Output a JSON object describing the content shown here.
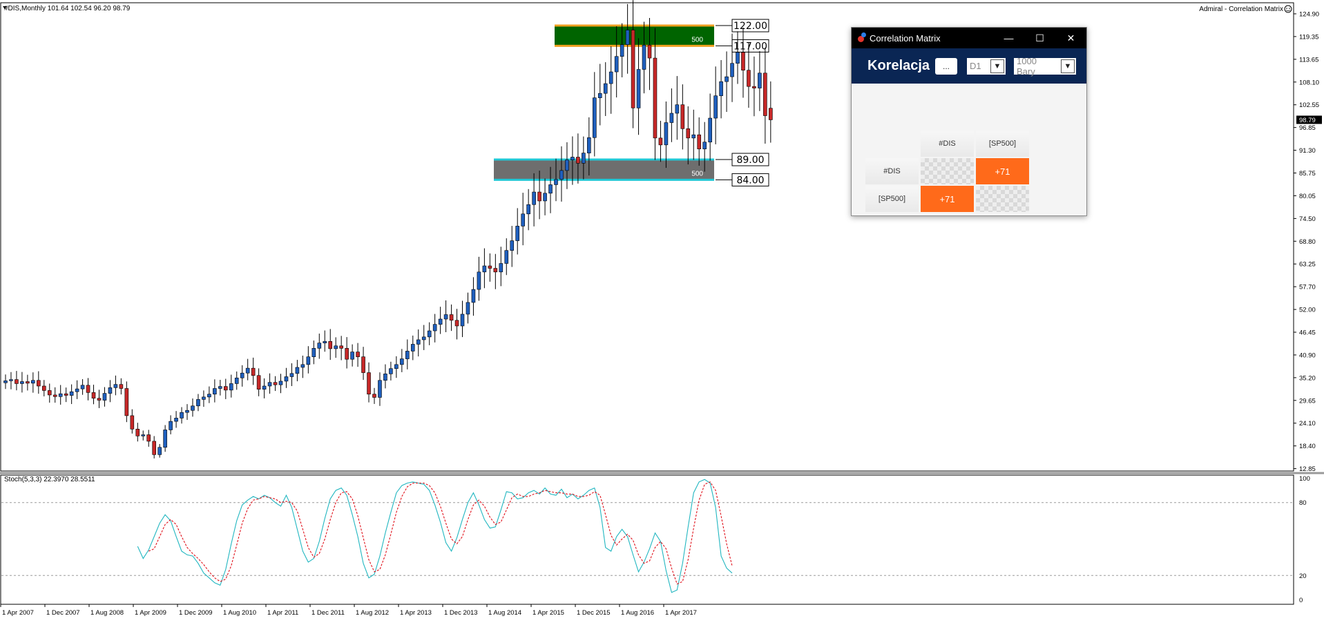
{
  "chart_header": "#DIS,Monthly  101.64 102.54 96.20 98.79",
  "top_right_label": "Admiral - Correlation Matrix",
  "indicator_header": "Stoch(5,3,3) 22.3970 28.5511",
  "current_price_label": "98.79",
  "colors": {
    "bull": "#1f5fbd",
    "bear": "#c62828",
    "stoch_main": "#20b6c0",
    "stoch_signal": "#e0101a",
    "accent": "#ff6a1a",
    "nav": "#0a2654"
  },
  "zones": [
    {
      "id": "resistance",
      "top": 122.0,
      "bottom": 117.0,
      "fill": "#006400",
      "border": "#f0a020",
      "volume": "500",
      "top_label": "122.00",
      "bottom_label": "117.00"
    },
    {
      "id": "support",
      "top": 89.0,
      "bottom": 84.0,
      "fill": "#6e6e6e",
      "border": "#20c8d6",
      "volume": "500",
      "top_label": "89.00",
      "bottom_label": "84.00"
    }
  ],
  "correlation_window": {
    "title": "Correlation Matrix",
    "heading": "Korelacja",
    "dots_button": "...",
    "timeframe": "D1",
    "bars": "1000 Bary",
    "row_headers": [
      "#DIS",
      "[SP500]"
    ],
    "col_headers": [
      "#DIS",
      "[SP500]"
    ],
    "values": [
      [
        "",
        "+71"
      ],
      [
        "+71",
        ""
      ]
    ]
  },
  "chart_data": [
    {
      "type": "candlestick",
      "x_tick_labels": [
        "1 Apr 2007",
        "1 Dec 2007",
        "1 Aug 2008",
        "1 Apr 2009",
        "1 Dec 2009",
        "1 Aug 2010",
        "1 Apr 2011",
        "1 Dec 2011",
        "1 Aug 2012",
        "1 Apr 2013",
        "1 Dec 2013",
        "1 Aug 2014",
        "1 Apr 2015",
        "1 Dec 2015",
        "1 Aug 2016",
        "1 Apr 2017"
      ],
      "y_tick_labels": [
        "124.90",
        "119.35",
        "113.65",
        "108.10",
        "102.55",
        "96.85",
        "91.30",
        "85.75",
        "80.05",
        "74.50",
        "68.80",
        "63.25",
        "57.70",
        "52.00",
        "46.45",
        "40.90",
        "35.20",
        "29.65",
        "24.10",
        "18.40",
        "12.85"
      ],
      "ylim": [
        12.85,
        124.9
      ],
      "x_start": "2007-01",
      "x_end": "2017-06",
      "close": [
        34.5,
        34.8,
        33.8,
        34.3,
        33.9,
        34.6,
        33.2,
        32.1,
        31.0,
        30.6,
        31.3,
        30.9,
        31.8,
        32.5,
        33.4,
        31.6,
        30.2,
        29.7,
        31.4,
        32.8,
        33.6,
        32.6,
        25.9,
        22.6,
        20.9,
        21.2,
        19.6,
        16.3,
        18.1,
        22.4,
        24.5,
        25.3,
        26.7,
        27.2,
        28.3,
        29.9,
        30.5,
        31.2,
        32.6,
        33.1,
        32.2,
        33.8,
        35.2,
        36.4,
        37.6,
        35.8,
        32.4,
        33.2,
        34.1,
        33.5,
        34.4,
        35.5,
        36.3,
        37.8,
        38.5,
        40.4,
        42.5,
        43.8,
        44.2,
        42.4,
        43.1,
        42.5,
        39.8,
        41.6,
        40.4,
        36.5,
        31.2,
        30.4,
        34.6,
        36.2,
        37.5,
        38.5,
        39.9,
        41.8,
        43.5,
        44.6,
        45.3,
        46.8,
        48.4,
        49.7,
        50.8,
        49.4,
        48.0,
        50.9,
        53.8,
        57.0,
        61.3,
        62.8,
        62.2,
        61.3,
        63.4,
        66.6,
        69.0,
        72.6,
        75.6,
        77.9,
        81.0,
        78.8,
        80.7,
        82.8,
        84.1,
        86.3,
        88.9,
        89.6,
        88.1,
        90.6,
        94.4,
        104.2,
        105.3,
        107.7,
        110.6,
        114.4,
        117.3,
        120.9,
        101.7,
        111.2,
        117.2,
        114.0,
        94.3,
        92.6,
        98.1,
        100.4,
        102.5,
        96.6,
        94.3,
        95.1,
        91.6,
        93.3,
        99.2,
        104.7,
        108.2,
        109.4,
        112.7,
        115.4,
        111.0,
        107.0,
        106.6,
        110.3,
        99.8,
        98.79
      ],
      "open": [
        34.0,
        34.5,
        34.8,
        33.8,
        34.3,
        33.9,
        34.6,
        33.2,
        32.1,
        31.0,
        30.6,
        31.3,
        30.9,
        31.8,
        32.5,
        33.4,
        31.6,
        30.2,
        29.7,
        31.4,
        32.8,
        33.6,
        32.6,
        25.9,
        22.6,
        20.9,
        21.2,
        19.6,
        16.3,
        18.1,
        22.4,
        24.5,
        25.3,
        26.7,
        27.2,
        28.3,
        29.9,
        30.5,
        31.2,
        32.6,
        33.1,
        32.2,
        33.8,
        35.2,
        36.4,
        37.6,
        35.8,
        32.4,
        33.2,
        34.1,
        33.5,
        34.4,
        35.5,
        36.3,
        37.8,
        38.5,
        40.4,
        42.5,
        43.8,
        44.2,
        42.4,
        43.1,
        42.5,
        39.8,
        41.6,
        40.4,
        36.5,
        31.2,
        30.4,
        34.6,
        36.2,
        37.5,
        38.5,
        39.9,
        41.8,
        43.5,
        44.6,
        45.3,
        46.8,
        48.4,
        49.7,
        50.8,
        49.4,
        48.0,
        50.9,
        53.8,
        57.0,
        61.3,
        62.8,
        62.2,
        61.3,
        63.4,
        66.6,
        69.0,
        72.6,
        75.6,
        77.9,
        81.0,
        78.8,
        80.7,
        82.8,
        84.1,
        86.3,
        88.9,
        89.6,
        88.1,
        90.6,
        94.4,
        104.2,
        105.3,
        107.7,
        110.6,
        114.4,
        117.3,
        120.9,
        101.7,
        111.2,
        117.2,
        114.0,
        94.3,
        92.6,
        98.1,
        100.4,
        102.5,
        96.6,
        94.3,
        95.1,
        91.6,
        93.3,
        99.2,
        104.7,
        108.2,
        109.4,
        112.7,
        115.4,
        111.0,
        107.0,
        106.6,
        110.3,
        101.64
      ]
    },
    {
      "type": "line",
      "name": "Stoch(5,3,3)",
      "ylim": [
        0,
        100
      ],
      "y_tick_labels": [
        "100",
        "80",
        "20",
        "0"
      ],
      "levels": [
        80,
        20
      ],
      "x_start": "2009-01",
      "series": [
        {
          "role": "main",
          "values": [
            44,
            34,
            41,
            52,
            63,
            70,
            65,
            52,
            40,
            37,
            36,
            30,
            22,
            18,
            14,
            12,
            25,
            46,
            65,
            78,
            82,
            85,
            83,
            86,
            84,
            80,
            77,
            86,
            76,
            58,
            40,
            31,
            34,
            48,
            67,
            83,
            90,
            92,
            86,
            70,
            52,
            30,
            18,
            21,
            36,
            55,
            72,
            88,
            94,
            96,
            97,
            96,
            95,
            90,
            78,
            64,
            47,
            40,
            51,
            66,
            80,
            88,
            78,
            66,
            59,
            60,
            74,
            89,
            88,
            83,
            84,
            88,
            90,
            87,
            92,
            87,
            86,
            91,
            84,
            87,
            83,
            86,
            90,
            92,
            76,
            43,
            40,
            52,
            58,
            52,
            37,
            23,
            31,
            42,
            55,
            48,
            24,
            6,
            8,
            30,
            60,
            88,
            97,
            99,
            96,
            76,
            36,
            26,
            22
          ]
        },
        {
          "role": "signal",
          "values": [
            null,
            null,
            40,
            42,
            52,
            62,
            66,
            62,
            52,
            43,
            38,
            34,
            29,
            23,
            18,
            15,
            17,
            28,
            45,
            63,
            75,
            82,
            83,
            85,
            84,
            83,
            80,
            81,
            80,
            73,
            58,
            43,
            35,
            38,
            50,
            66,
            80,
            88,
            89,
            83,
            69,
            51,
            33,
            23,
            25,
            37,
            54,
            72,
            85,
            93,
            96,
            96,
            96,
            94,
            88,
            77,
            63,
            50,
            46,
            52,
            66,
            78,
            82,
            77,
            68,
            62,
            64,
            74,
            84,
            87,
            85,
            85,
            87,
            88,
            90,
            89,
            88,
            88,
            87,
            87,
            85,
            85,
            86,
            89,
            86,
            70,
            53,
            45,
            50,
            54,
            49,
            37,
            30,
            32,
            43,
            48,
            42,
            26,
            13,
            15,
            33,
            59,
            82,
            95,
            97,
            90,
            69,
            46,
            28
          ]
        }
      ]
    }
  ]
}
